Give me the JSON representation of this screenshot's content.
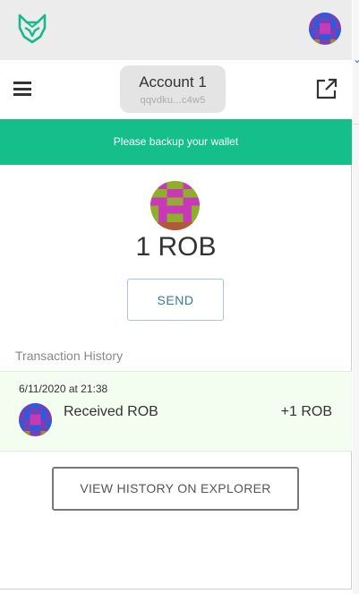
{
  "topbar": {
    "logo_icon": "fox-logo-icon",
    "avatar_icon": "identicon-avatar-icon"
  },
  "header": {
    "menu_icon": "hamburger-menu-icon",
    "account_name": "Account 1",
    "account_address": "qqvdku...c4w5",
    "external_icon": "external-link-icon"
  },
  "banner": {
    "text": "Please backup your wallet",
    "color": "#14bf8a"
  },
  "wallet": {
    "token_icon": "token-identicon-icon",
    "balance": "1 ROB",
    "send_label": "SEND"
  },
  "history": {
    "title": "Transaction History",
    "transactions": [
      {
        "date": "6/11/2020 at 21:38",
        "label": "Received ROB",
        "amount": "+1 ROB",
        "icon": "identicon-avatar-icon"
      }
    ],
    "explorer_label": "VIEW HISTORY ON EXPLORER"
  },
  "colors": {
    "accent_green": "#14bf8a",
    "send_text": "#3a77a8",
    "row_highlight": "#f3fdf0"
  }
}
